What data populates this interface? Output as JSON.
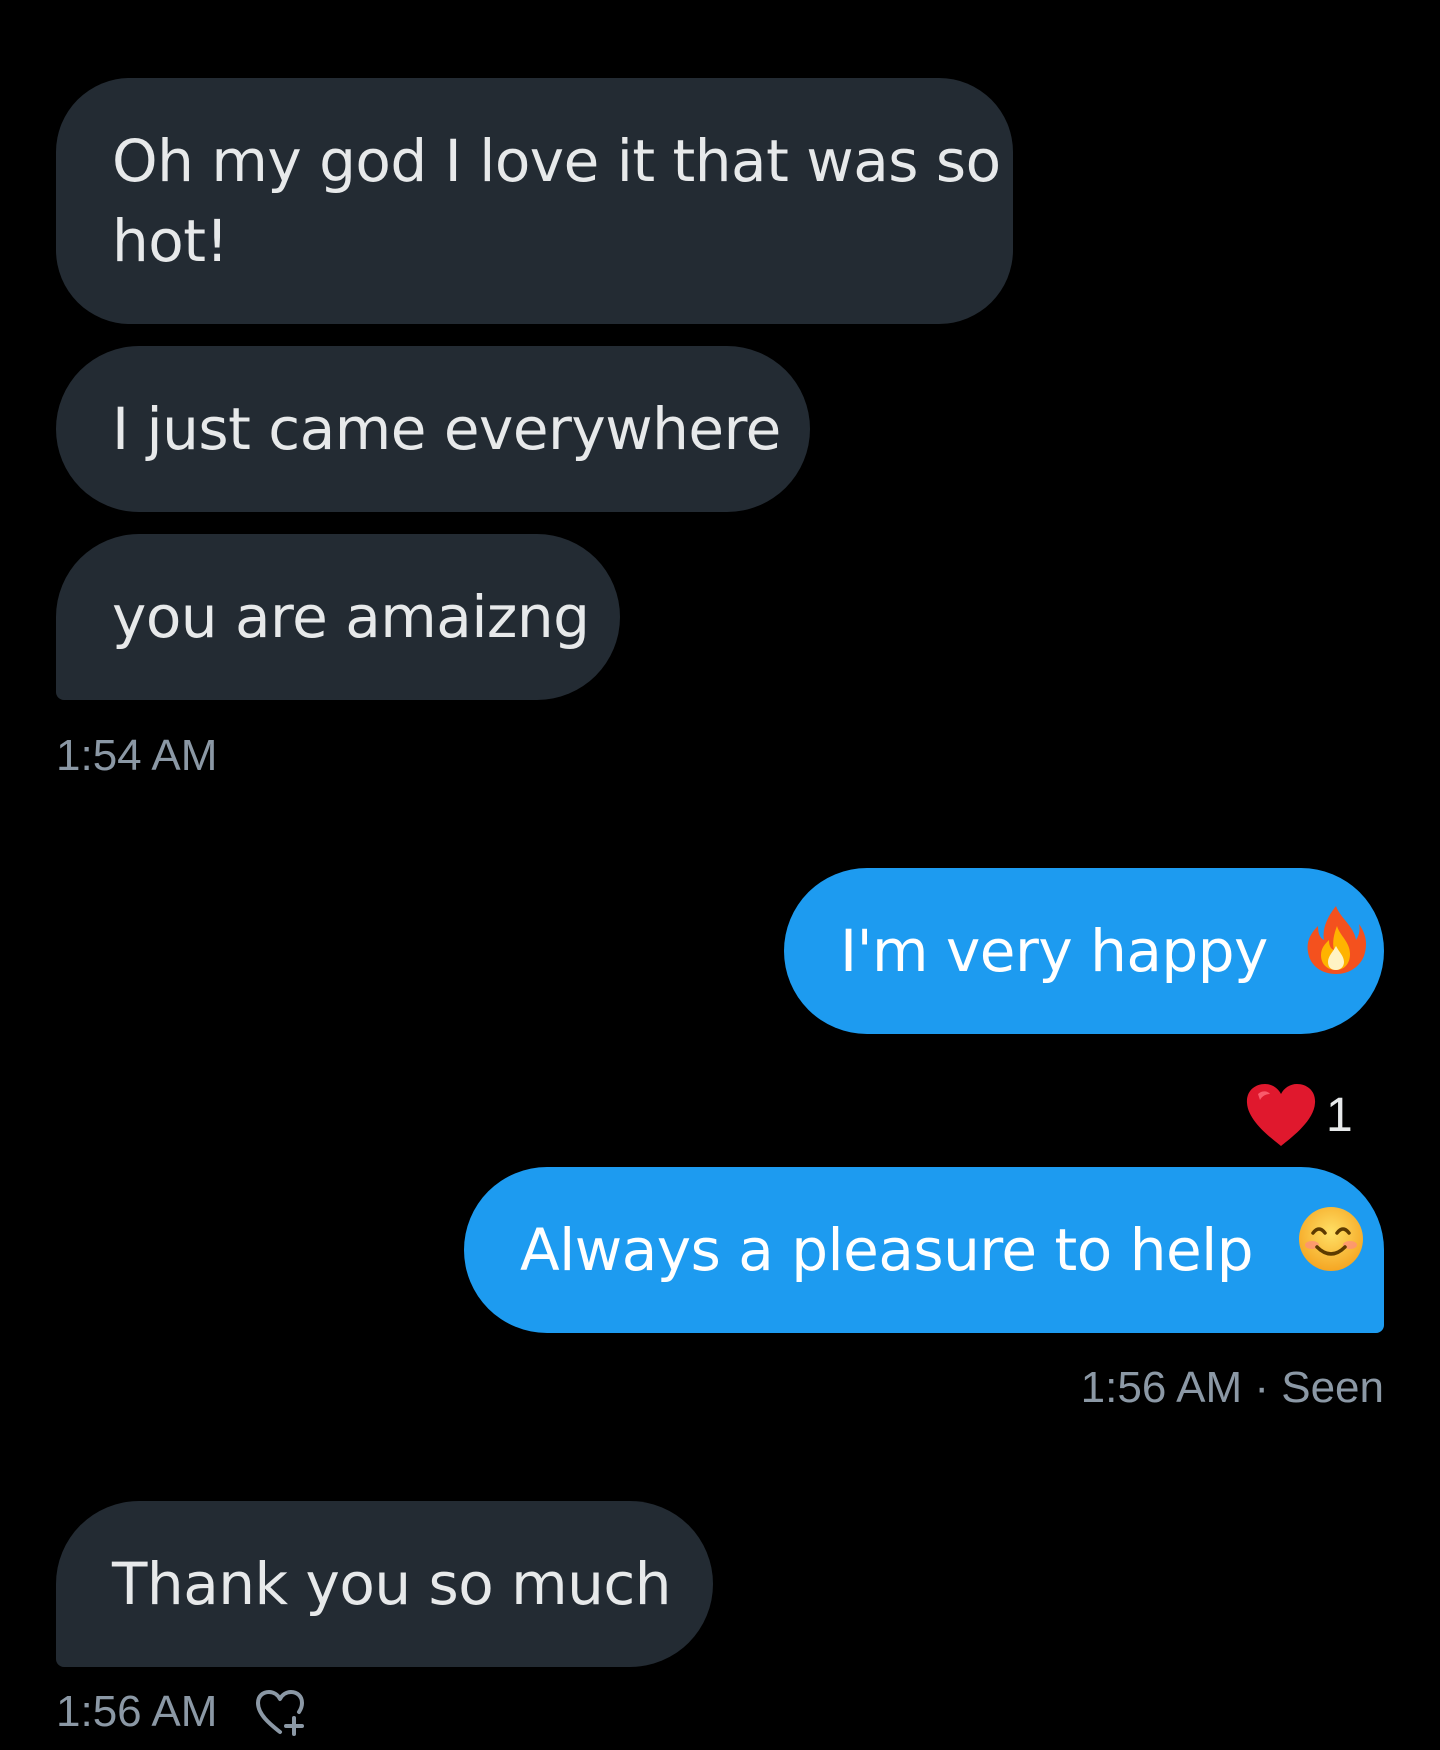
{
  "conversation": {
    "received_group_1": [
      {
        "line1": "Oh my god I love it that was so",
        "line2": "hot!"
      },
      {
        "text": "I just came everywhere"
      },
      {
        "text": "you are amaizng"
      }
    ],
    "received_group_1_time": "1:54 AM",
    "sent_1": {
      "text": "I'm very happy",
      "emoji": "fire-icon"
    },
    "reaction": {
      "emoji": "heart-icon",
      "count": "1",
      "color": "#e0182d"
    },
    "sent_2": {
      "text": "Always a pleasure to help",
      "emoji": "smiling-face-icon"
    },
    "sent_time": "1:56 AM",
    "sent_separator": "·",
    "sent_status": "Seen",
    "received_2": {
      "text": "Thank you so much"
    },
    "received_2_time": "1:56 AM",
    "react_button_icon": "heart-plus-icon"
  },
  "colors": {
    "background": "#000000",
    "received_bubble": "#232b33",
    "sent_bubble": "#1d9bf0",
    "meta_text": "#8b98a5"
  }
}
